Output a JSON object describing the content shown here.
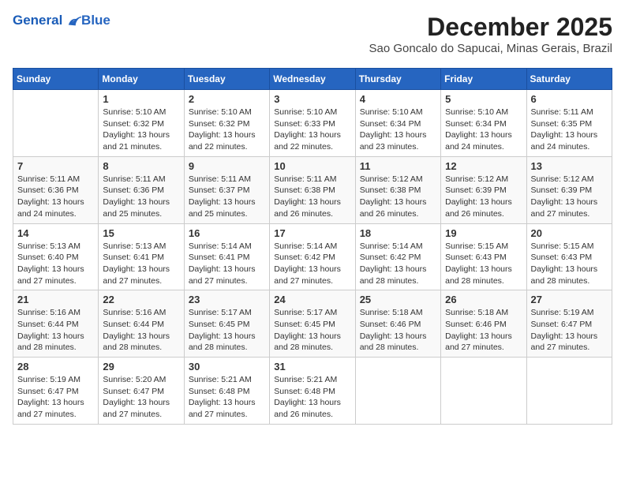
{
  "logo": {
    "line1": "General",
    "line2": "Blue"
  },
  "title": "December 2025",
  "subtitle": "Sao Goncalo do Sapucai, Minas Gerais, Brazil",
  "weekdays": [
    "Sunday",
    "Monday",
    "Tuesday",
    "Wednesday",
    "Thursday",
    "Friday",
    "Saturday"
  ],
  "weeks": [
    [
      {
        "num": "",
        "info": ""
      },
      {
        "num": "1",
        "info": "Sunrise: 5:10 AM\nSunset: 6:32 PM\nDaylight: 13 hours\nand 21 minutes."
      },
      {
        "num": "2",
        "info": "Sunrise: 5:10 AM\nSunset: 6:32 PM\nDaylight: 13 hours\nand 22 minutes."
      },
      {
        "num": "3",
        "info": "Sunrise: 5:10 AM\nSunset: 6:33 PM\nDaylight: 13 hours\nand 22 minutes."
      },
      {
        "num": "4",
        "info": "Sunrise: 5:10 AM\nSunset: 6:34 PM\nDaylight: 13 hours\nand 23 minutes."
      },
      {
        "num": "5",
        "info": "Sunrise: 5:10 AM\nSunset: 6:34 PM\nDaylight: 13 hours\nand 24 minutes."
      },
      {
        "num": "6",
        "info": "Sunrise: 5:11 AM\nSunset: 6:35 PM\nDaylight: 13 hours\nand 24 minutes."
      }
    ],
    [
      {
        "num": "7",
        "info": "Sunrise: 5:11 AM\nSunset: 6:36 PM\nDaylight: 13 hours\nand 24 minutes."
      },
      {
        "num": "8",
        "info": "Sunrise: 5:11 AM\nSunset: 6:36 PM\nDaylight: 13 hours\nand 25 minutes."
      },
      {
        "num": "9",
        "info": "Sunrise: 5:11 AM\nSunset: 6:37 PM\nDaylight: 13 hours\nand 25 minutes."
      },
      {
        "num": "10",
        "info": "Sunrise: 5:11 AM\nSunset: 6:38 PM\nDaylight: 13 hours\nand 26 minutes."
      },
      {
        "num": "11",
        "info": "Sunrise: 5:12 AM\nSunset: 6:38 PM\nDaylight: 13 hours\nand 26 minutes."
      },
      {
        "num": "12",
        "info": "Sunrise: 5:12 AM\nSunset: 6:39 PM\nDaylight: 13 hours\nand 26 minutes."
      },
      {
        "num": "13",
        "info": "Sunrise: 5:12 AM\nSunset: 6:39 PM\nDaylight: 13 hours\nand 27 minutes."
      }
    ],
    [
      {
        "num": "14",
        "info": "Sunrise: 5:13 AM\nSunset: 6:40 PM\nDaylight: 13 hours\nand 27 minutes."
      },
      {
        "num": "15",
        "info": "Sunrise: 5:13 AM\nSunset: 6:41 PM\nDaylight: 13 hours\nand 27 minutes."
      },
      {
        "num": "16",
        "info": "Sunrise: 5:14 AM\nSunset: 6:41 PM\nDaylight: 13 hours\nand 27 minutes."
      },
      {
        "num": "17",
        "info": "Sunrise: 5:14 AM\nSunset: 6:42 PM\nDaylight: 13 hours\nand 27 minutes."
      },
      {
        "num": "18",
        "info": "Sunrise: 5:14 AM\nSunset: 6:42 PM\nDaylight: 13 hours\nand 28 minutes."
      },
      {
        "num": "19",
        "info": "Sunrise: 5:15 AM\nSunset: 6:43 PM\nDaylight: 13 hours\nand 28 minutes."
      },
      {
        "num": "20",
        "info": "Sunrise: 5:15 AM\nSunset: 6:43 PM\nDaylight: 13 hours\nand 28 minutes."
      }
    ],
    [
      {
        "num": "21",
        "info": "Sunrise: 5:16 AM\nSunset: 6:44 PM\nDaylight: 13 hours\nand 28 minutes."
      },
      {
        "num": "22",
        "info": "Sunrise: 5:16 AM\nSunset: 6:44 PM\nDaylight: 13 hours\nand 28 minutes."
      },
      {
        "num": "23",
        "info": "Sunrise: 5:17 AM\nSunset: 6:45 PM\nDaylight: 13 hours\nand 28 minutes."
      },
      {
        "num": "24",
        "info": "Sunrise: 5:17 AM\nSunset: 6:45 PM\nDaylight: 13 hours\nand 28 minutes."
      },
      {
        "num": "25",
        "info": "Sunrise: 5:18 AM\nSunset: 6:46 PM\nDaylight: 13 hours\nand 28 minutes."
      },
      {
        "num": "26",
        "info": "Sunrise: 5:18 AM\nSunset: 6:46 PM\nDaylight: 13 hours\nand 27 minutes."
      },
      {
        "num": "27",
        "info": "Sunrise: 5:19 AM\nSunset: 6:47 PM\nDaylight: 13 hours\nand 27 minutes."
      }
    ],
    [
      {
        "num": "28",
        "info": "Sunrise: 5:19 AM\nSunset: 6:47 PM\nDaylight: 13 hours\nand 27 minutes."
      },
      {
        "num": "29",
        "info": "Sunrise: 5:20 AM\nSunset: 6:47 PM\nDaylight: 13 hours\nand 27 minutes."
      },
      {
        "num": "30",
        "info": "Sunrise: 5:21 AM\nSunset: 6:48 PM\nDaylight: 13 hours\nand 27 minutes."
      },
      {
        "num": "31",
        "info": "Sunrise: 5:21 AM\nSunset: 6:48 PM\nDaylight: 13 hours\nand 26 minutes."
      },
      {
        "num": "",
        "info": ""
      },
      {
        "num": "",
        "info": ""
      },
      {
        "num": "",
        "info": ""
      }
    ]
  ]
}
